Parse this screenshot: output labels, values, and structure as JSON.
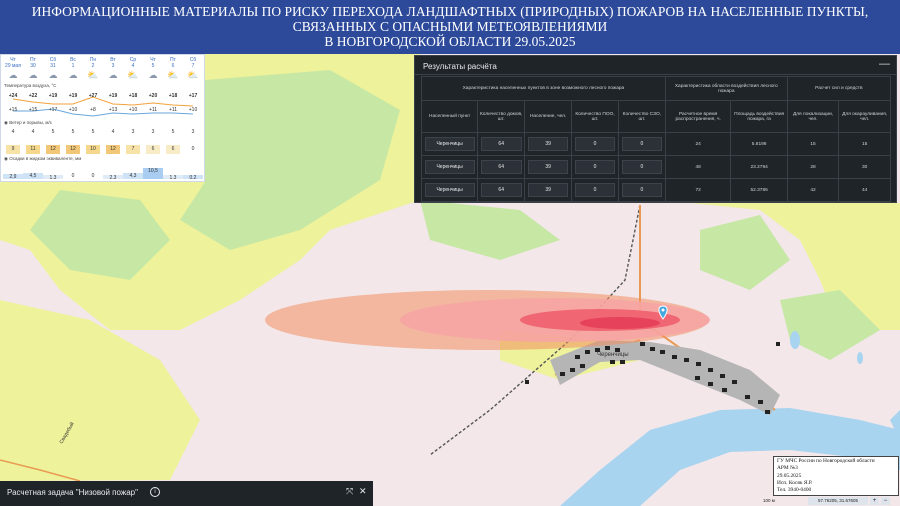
{
  "header": {
    "line1": "ИНФОРМАЦИОННЫЕ МАТЕРИАЛЫ ПО РИСКУ ПЕРЕХОДА ЛАНДШАФТНЫХ (ПРИРОДНЫХ) ПОЖАРОВ НА НАСЕЛЕННЫЕ ПУНКТЫ,",
    "line2": "СВЯЗАННЫХ С ОПАСНЫМИ МЕТЕОЯВЛЕНИЯМИ",
    "line3": "В НОВГОРОДСКОЙ ОБЛАСТИ 29.05.2025"
  },
  "weather": {
    "days": [
      "Чт",
      "Пт",
      "Сб",
      "Вс",
      "Пн",
      "Вт",
      "Ср",
      "Чт",
      "Пт",
      "Сб"
    ],
    "dates": [
      "29 мая",
      "30",
      "31",
      "1",
      "2",
      "3",
      "4",
      "5",
      "6",
      "7"
    ],
    "temp_label": "Температура воздуха, °C",
    "temp_high": [
      "+24",
      "+22",
      "+19",
      "+19",
      "+27",
      "+19",
      "+18",
      "+20",
      "+18",
      "+17"
    ],
    "temp_low": [
      "+15",
      "+15",
      "+17",
      "+10",
      "+8",
      "+13",
      "+10",
      "+11",
      "+11",
      "+10"
    ],
    "wind_label": "Ветер и порывы, м/с",
    "wind": [
      "4",
      "4",
      "5",
      "5",
      "5",
      "4",
      "3",
      "3",
      "5",
      "3"
    ],
    "gusts": [
      "9",
      "11",
      "12",
      "12",
      "10",
      "12",
      "7",
      "6",
      "6",
      "0"
    ],
    "precip_label": "Осадки в жидком эквиваленте, мм",
    "precip": [
      "2,9",
      "4,5",
      "1,3",
      "0",
      "0",
      "2,3",
      "4,3",
      "10,5",
      "1,3",
      "0,2"
    ]
  },
  "panel": {
    "title": "Результаты расчёта",
    "minimize": "—",
    "groups": [
      "Характеристика населенных пунктов в зоне возможного лесного пожара",
      "Характеристика области воздействия лесного пожара",
      "Расчет сил и средств"
    ],
    "columns": [
      "Населенный пункт",
      "Количество домов, шт.",
      "Население, чел.",
      "Количество ПОО, шт.",
      "Количество СЗО, шт.",
      "Расчетное время распространения, ч.",
      "Площадь воздействия пожара, га",
      "Для локализации, чел.",
      "Для окарауливания, чел."
    ],
    "rows": [
      [
        "Черенчицы",
        "64",
        "39",
        "0",
        "0",
        "24",
        "5.8198",
        "15",
        "15"
      ],
      [
        "Черенчицы",
        "64",
        "39",
        "0",
        "0",
        "48",
        "23.2794",
        "28",
        "30"
      ],
      [
        "Черенчицы",
        "64",
        "39",
        "0",
        "0",
        "72",
        "52.3786",
        "42",
        "44"
      ]
    ]
  },
  "task": {
    "label": "Расчетная задача \"Низовой пожар\"",
    "info": "i",
    "expand": "⤧",
    "close": "✕"
  },
  "map": {
    "village_label": "Черенчицы",
    "road_label": "Свадебый"
  },
  "stamp": {
    "line1": "ГУ МЧС России по Новгородской области",
    "line2": "АРМ №3",
    "line3": "29.05.2025",
    "line4": "Исп. Косяк Я.Р.",
    "line5": "Тел. 3940-0400"
  },
  "scale": "100 м",
  "coords": "57.76205, 31.67605"
}
